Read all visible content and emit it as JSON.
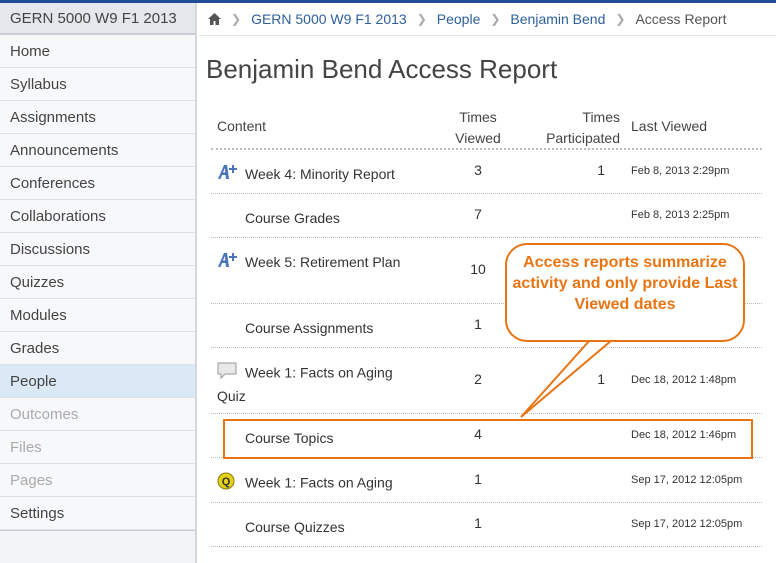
{
  "sidebar": {
    "course": "GERN 5000 W9 F1 2013",
    "items": [
      {
        "label": "Home",
        "state": "normal"
      },
      {
        "label": "Syllabus",
        "state": "normal"
      },
      {
        "label": "Assignments",
        "state": "normal"
      },
      {
        "label": "Announcements",
        "state": "normal"
      },
      {
        "label": "Conferences",
        "state": "normal"
      },
      {
        "label": "Collaborations",
        "state": "normal"
      },
      {
        "label": "Discussions",
        "state": "normal"
      },
      {
        "label": "Quizzes",
        "state": "normal"
      },
      {
        "label": "Modules",
        "state": "normal"
      },
      {
        "label": "Grades",
        "state": "normal"
      },
      {
        "label": "People",
        "state": "active"
      },
      {
        "label": "Outcomes",
        "state": "disabled"
      },
      {
        "label": "Files",
        "state": "disabled"
      },
      {
        "label": "Pages",
        "state": "disabled"
      },
      {
        "label": "Settings",
        "state": "normal"
      }
    ]
  },
  "breadcrumb": [
    "GERN 5000 W9 F1 2013",
    "People",
    "Benjamin Bend",
    "Access Report"
  ],
  "title": "Benjamin Bend Access Report",
  "table": {
    "headers": {
      "content": "Content",
      "views": "Times Viewed",
      "participated": "Times Participated",
      "last": "Last Viewed"
    },
    "rows": [
      {
        "icon": "assignment-icon",
        "content": "Week 4: Minority Report",
        "views": "3",
        "participated": "1",
        "last": "Feb 8, 2013 2:29pm"
      },
      {
        "icon": "",
        "content": "Course Grades",
        "views": "7",
        "participated": "",
        "last": "Feb 8, 2013 2:25pm"
      },
      {
        "icon": "assignment-icon",
        "content": "Week 5: Retirement Plan",
        "views": "10",
        "participated": "",
        "last": ""
      },
      {
        "icon": "",
        "content": "Course Assignments",
        "views": "1",
        "participated": "",
        "last": ""
      },
      {
        "icon": "discussion-icon",
        "content": "Week 1: Facts on Aging Quiz",
        "views": "2",
        "participated": "1",
        "last": "Dec 18, 2012 1:48pm"
      },
      {
        "icon": "",
        "content": "Course Topics",
        "views": "4",
        "participated": "",
        "last": "Dec 18, 2012 1:46pm"
      },
      {
        "icon": "quiz-icon",
        "content": "Week 1: Facts on Aging",
        "views": "1",
        "participated": "",
        "last": "Sep 17, 2012 12:05pm"
      },
      {
        "icon": "",
        "content": "Course Quizzes",
        "views": "1",
        "participated": "",
        "last": "Sep 17, 2012 12:05pm"
      }
    ]
  },
  "callout": "Access reports summarize activity and only provide Last Viewed dates",
  "colors": {
    "accent": "#e87514",
    "link": "#2d5f9c",
    "active": "#dbe9f6"
  }
}
